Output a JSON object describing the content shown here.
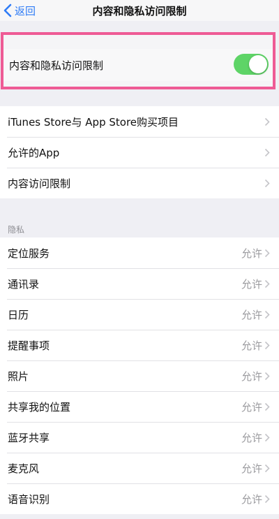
{
  "nav": {
    "back_label": "返回",
    "title": "内容和隐私访问限制"
  },
  "toggle_row": {
    "label": "内容和隐私访问限制",
    "on": true
  },
  "menu_group": [
    {
      "label": "iTunes Store与 App Store购买项目"
    },
    {
      "label": "允许的App"
    },
    {
      "label": "内容访问限制"
    }
  ],
  "privacy_header": "隐私",
  "privacy_items": [
    {
      "label": "定位服务",
      "value": "允许"
    },
    {
      "label": "通讯录",
      "value": "允许"
    },
    {
      "label": "日历",
      "value": "允许"
    },
    {
      "label": "提醒事项",
      "value": "允许"
    },
    {
      "label": "照片",
      "value": "允许"
    },
    {
      "label": "共享我的位置",
      "value": "允许"
    },
    {
      "label": "蓝牙共享",
      "value": "允许"
    },
    {
      "label": "麦克风",
      "value": "允许"
    },
    {
      "label": "语音识别",
      "value": "允许"
    }
  ],
  "colors": {
    "accent": "#2f7cf6",
    "toggle_on": "#5ed467",
    "highlight": "#ee5b95"
  }
}
